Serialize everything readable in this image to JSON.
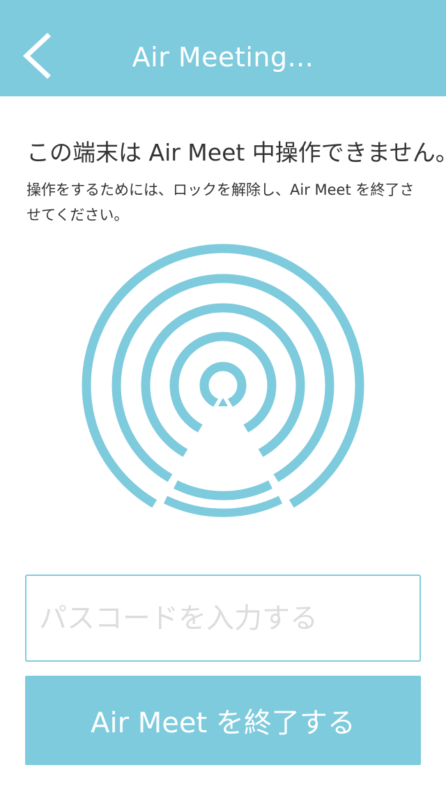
{
  "colors": {
    "accent": "#7ecbdd",
    "text": "#333333",
    "placeholder": "#dcdcdc",
    "background": "#ffffff"
  },
  "nav": {
    "back_icon": "chevron-left-icon",
    "title": "Air Meeting..."
  },
  "message": {
    "title": "この端末は Air Meet 中操作できません。",
    "body": "操作をするためには、ロックを解除し、Air Meet を終了させてください。"
  },
  "illustration": {
    "icon": "broadcast-signal-icon"
  },
  "passcode": {
    "value": "",
    "placeholder": "パスコードを入力する"
  },
  "end_button": {
    "label": "Air Meet を終了する"
  }
}
